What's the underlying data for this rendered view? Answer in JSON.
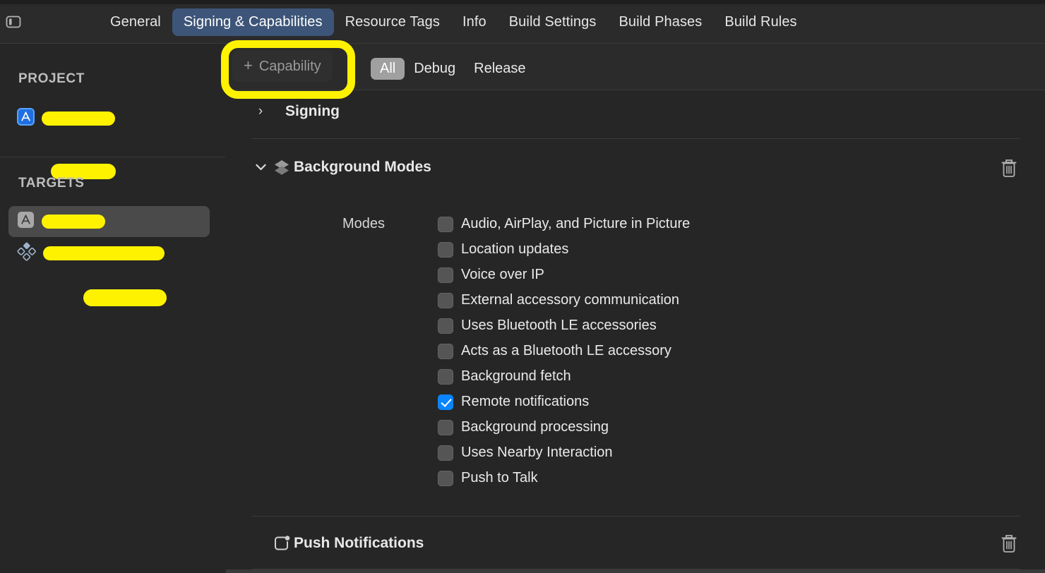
{
  "window": {
    "sidebar_toggle_icon": "sidebar-toggle-icon",
    "background_color": "#262626",
    "accent_color": "#0A84FF",
    "annotation_color": "#FFF200"
  },
  "tabs": [
    {
      "label": "General",
      "active": false
    },
    {
      "label": "Signing & Capabilities",
      "active": true
    },
    {
      "label": "Resource Tags",
      "active": false
    },
    {
      "label": "Info",
      "active": false
    },
    {
      "label": "Build Settings",
      "active": false
    },
    {
      "label": "Build Phases",
      "active": false
    },
    {
      "label": "Build Rules",
      "active": false
    }
  ],
  "toolbar": {
    "add_capability_label": "Capability",
    "plus_glyph": "+",
    "filters": [
      {
        "label": "All",
        "active": true
      },
      {
        "label": "Debug",
        "active": false
      },
      {
        "label": "Release",
        "active": false
      }
    ]
  },
  "sidebar": {
    "project_section_label": "PROJECT",
    "targets_section_label": "TARGETS",
    "project_items": [
      {
        "icon": "app-store-icon",
        "label": "",
        "redacted": true,
        "selected": false
      }
    ],
    "target_items": [
      {
        "icon": "app-icon",
        "label": "",
        "redacted": true,
        "selected": true
      },
      {
        "icon": "extension-diamonds-icon",
        "label": "",
        "redacted": true,
        "selected": false
      }
    ]
  },
  "capabilities": [
    {
      "title": "Signing",
      "icon": "",
      "expanded": false,
      "disclosure_glyph": "›",
      "has_delete": false,
      "delete_icon": ""
    },
    {
      "title": "Background Modes",
      "icon": "layers-icon",
      "expanded": true,
      "disclosure_glyph": "∨",
      "has_delete": true,
      "delete_icon": "trash-icon",
      "field_label": "Modes",
      "modes": [
        {
          "label": "Audio, AirPlay, and Picture in Picture",
          "checked": false
        },
        {
          "label": "Location updates",
          "checked": false
        },
        {
          "label": "Voice over IP",
          "checked": false
        },
        {
          "label": "External accessory communication",
          "checked": false
        },
        {
          "label": "Uses Bluetooth LE accessories",
          "checked": false
        },
        {
          "label": "Acts as a Bluetooth LE accessory",
          "checked": false
        },
        {
          "label": "Background fetch",
          "checked": false
        },
        {
          "label": "Remote notifications",
          "checked": true
        },
        {
          "label": "Background processing",
          "checked": false
        },
        {
          "label": "Uses Nearby Interaction",
          "checked": false
        },
        {
          "label": "Push to Talk",
          "checked": false
        }
      ]
    },
    {
      "title": "Push Notifications",
      "icon": "push-notification-icon",
      "expanded": false,
      "disclosure_glyph": "",
      "has_delete": true,
      "delete_icon": "trash-icon"
    }
  ]
}
